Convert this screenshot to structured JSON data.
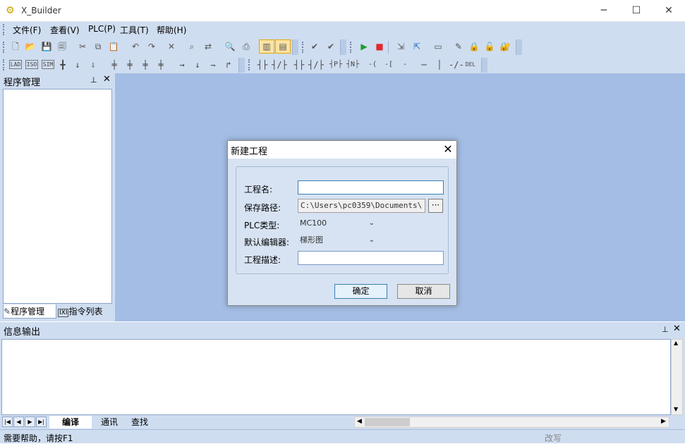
{
  "window": {
    "title": "X_Builder",
    "minimize": "─",
    "maximize": "☐",
    "close": "✕"
  },
  "menubar": {
    "items": [
      "文件(F)",
      "查看(V)",
      "PLC(P)",
      "工具(T)",
      "帮助(H)"
    ]
  },
  "toolbar1": {
    "icons": [
      "new-file-icon",
      "open-folder-icon",
      "save-icon",
      "save-all-icon",
      "cut-icon",
      "copy-icon",
      "paste-icon",
      "undo-icon",
      "redo-icon",
      "delete-icon",
      "find-icon",
      "replace-icon",
      "print-preview-icon",
      "print-icon",
      "layout-left-icon",
      "layout-bottom-icon",
      "check-icon",
      "check-all-icon",
      "run-icon",
      "stop-icon",
      "download-icon",
      "upload-icon",
      "monitor-icon",
      "edit-icon",
      "lock-icon",
      "lock-open-icon",
      "lock-key-icon"
    ]
  },
  "toolbar2": {
    "labels": [
      "LAD",
      "ISO",
      "SIM"
    ],
    "glyphs": [
      "╋",
      "↓",
      "⇩",
      "╪",
      "╪",
      "╪",
      "╪",
      "→",
      "↓",
      "⇁",
      "↱"
    ],
    "ladder": [
      "┤├",
      "┤/├",
      "┤├",
      "┤/├",
      "┤P├",
      "┤N├",
      "-( )-",
      "-[ ]-",
      "-[F]-",
      "─",
      "│",
      "-/-",
      "DEL"
    ]
  },
  "left_panel": {
    "title": "程序管理",
    "pin": "🖈",
    "close": "✕",
    "tabs": [
      "程序管理",
      "指令列表"
    ]
  },
  "info_panel": {
    "title": "信息输出",
    "pin": "🖈",
    "close": "✕",
    "tabs": [
      "编译",
      "通讯",
      "查找"
    ],
    "nav": [
      "|◀",
      "◀",
      "▶",
      "▶|"
    ]
  },
  "statusbar": {
    "help": "需要帮助，请按F1",
    "mode": "改写"
  },
  "dialog": {
    "title": "新建工程",
    "close": "✕",
    "fields": {
      "name_label": "工程名:",
      "name_value": "",
      "path_label": "保存路径:",
      "path_value": "C:\\Users\\pc0359\\Documents\\",
      "browse": "···",
      "plc_label": "PLC类型:",
      "plc_value": "MC100",
      "editor_label": "默认编辑器:",
      "editor_value": "梯形图",
      "desc_label": "工程描述:",
      "desc_value": ""
    },
    "ok": "确定",
    "cancel": "取消"
  },
  "colors": {
    "panel": "#cfddf0",
    "workspace": "#a4bde4",
    "dialog_body": "#d7e3f3"
  }
}
